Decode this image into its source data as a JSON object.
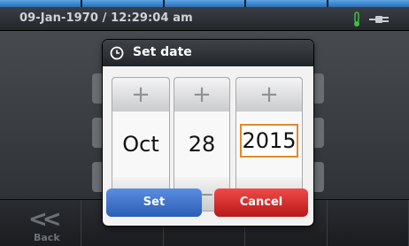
{
  "status_bar": {
    "datetime": "09-Jan-1970 / 12:29:04 am",
    "icons": [
      "thermometer-icon",
      "plug-icon"
    ]
  },
  "nav": {
    "back_label": "Back"
  },
  "dialog": {
    "title": "Set date",
    "icon": "clock-icon",
    "month": {
      "value": "Oct"
    },
    "day": {
      "value": "28"
    },
    "year": {
      "value": "2015",
      "selected": true
    },
    "increment_symbol": "+",
    "decrement_symbol": "—",
    "set_label": "Set",
    "cancel_label": "Cancel"
  },
  "colors": {
    "accent_blue": "#2c5db5",
    "accent_red": "#d22a2a",
    "selection_orange": "#e08a2c",
    "thermometer_green": "#3fbf3f"
  }
}
